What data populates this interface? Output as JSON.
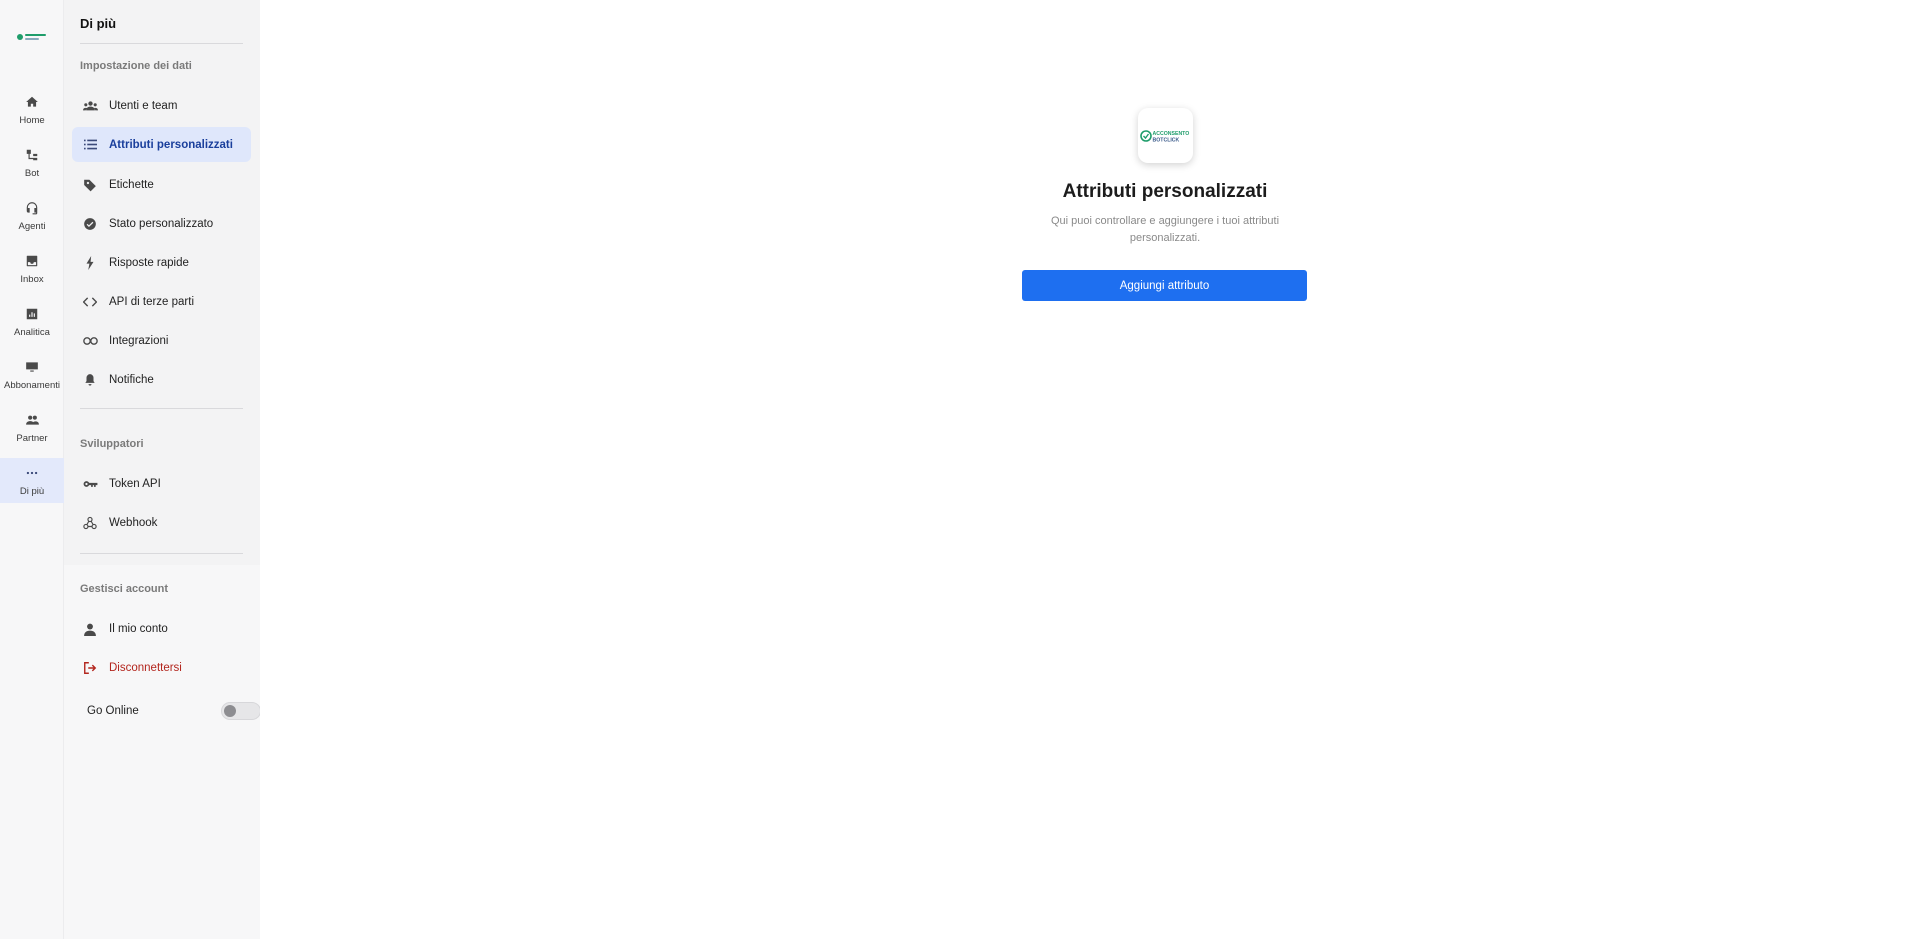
{
  "brand": {
    "logo_line1": "ACCONSENTO",
    "logo_line2": "BOTCLICK",
    "primary": "#1e6ff0",
    "accent_green": "#1f9d6b"
  },
  "rail": {
    "items": [
      {
        "label": "Home",
        "icon": "home-icon"
      },
      {
        "label": "Bot",
        "icon": "bot-icon"
      },
      {
        "label": "Agenti",
        "icon": "headset-icon"
      },
      {
        "label": "Inbox",
        "icon": "inbox-icon"
      },
      {
        "label": "Analitica",
        "icon": "analytics-icon"
      },
      {
        "label": "Abbonamenti",
        "icon": "monitor-icon"
      },
      {
        "label": "Partner",
        "icon": "people-icon"
      },
      {
        "label": "Di più",
        "icon": "more-icon",
        "active": true
      }
    ]
  },
  "sidebar": {
    "title": "Di più",
    "sections": [
      {
        "heading": "Impostazione dei dati",
        "items": [
          {
            "label": "Utenti e team",
            "icon": "users-icon"
          },
          {
            "label": "Attributi personalizzati",
            "icon": "list-icon",
            "active": true
          },
          {
            "label": "Etichette",
            "icon": "tag-icon"
          },
          {
            "label": "Stato personalizzato",
            "icon": "check-circle-icon"
          },
          {
            "label": "Risposte rapide",
            "icon": "bolt-icon"
          },
          {
            "label": "API di terze parti",
            "icon": "code-icon"
          },
          {
            "label": "Integrazioni",
            "icon": "link-icon"
          },
          {
            "label": "Notifiche",
            "icon": "bell-icon"
          }
        ]
      },
      {
        "heading": "Sviluppatori",
        "items": [
          {
            "label": "Token API",
            "icon": "key-icon"
          },
          {
            "label": "Webhook",
            "icon": "webhook-icon"
          }
        ]
      },
      {
        "heading": "Gestisci account",
        "items": [
          {
            "label": "Il mio conto",
            "icon": "person-icon"
          },
          {
            "label": "Disconnettersi",
            "icon": "logout-icon"
          }
        ]
      }
    ],
    "go_online": {
      "label": "Go Online",
      "on": false
    }
  },
  "main": {
    "title": "Attributi personalizzati",
    "subtitle": "Qui puoi controllare e aggiungere i tuoi attributi personalizzati.",
    "button_label": "Aggiungi attributo"
  }
}
